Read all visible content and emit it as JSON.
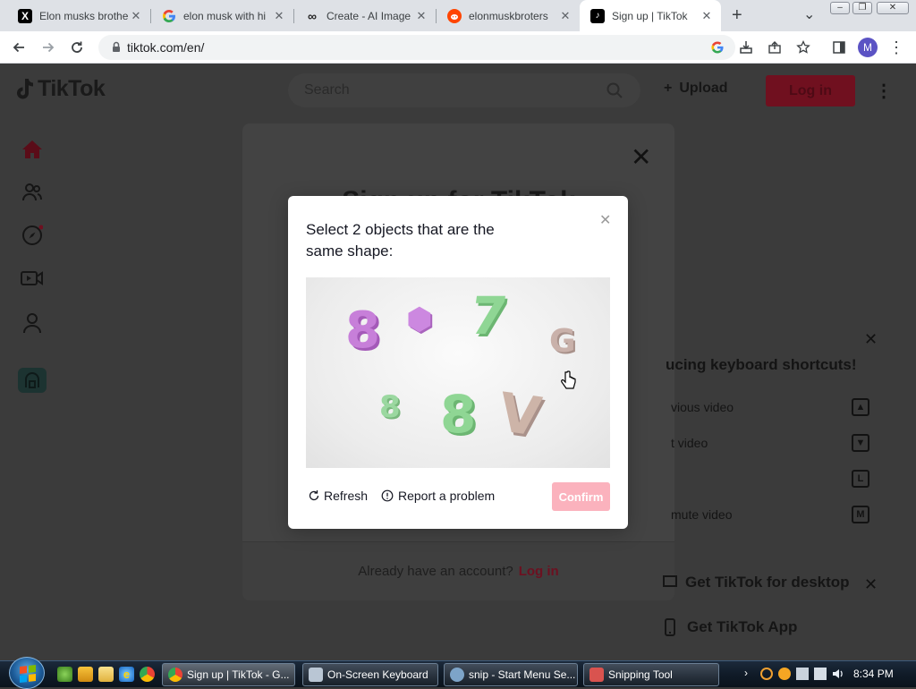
{
  "browser": {
    "tabs": [
      {
        "title": "Elon musks brothe",
        "favicon": "x-logo-icon"
      },
      {
        "title": "elon musk with hi",
        "favicon": "google-icon"
      },
      {
        "title": "Create - AI Image",
        "favicon": "infinity-icon"
      },
      {
        "title": "elonmuskbroters",
        "favicon": "reddit-icon"
      },
      {
        "title": "Sign up | TikTok",
        "favicon": "tiktok-icon"
      }
    ],
    "new_tab_icon": "+",
    "tab_menu_icon": "⌄",
    "url": "tiktok.com/en/",
    "profile_initial": "M"
  },
  "tiktok": {
    "logo_text": "TikTok",
    "search_placeholder": "Search",
    "upload_label": "Upload",
    "login_label": "Log in"
  },
  "signup_modal": {
    "title": "Sign up for TikTok",
    "footer_text": "Already have an account?",
    "footer_link": "Log in"
  },
  "shortcuts_panel": {
    "title": "ucing keyboard shortcuts!",
    "rows": [
      {
        "label": "vious video",
        "key": "▲"
      },
      {
        "label": "t video",
        "key": "▼"
      },
      {
        "label": "",
        "key": "L"
      },
      {
        "label": "mute video",
        "key": "M"
      }
    ],
    "promo_desktop": "Get TikTok for desktop",
    "promo_app": "Get TikTok App"
  },
  "captcha": {
    "title": "Select 2 objects that are the same shape:",
    "objects": [
      {
        "glyph": "8",
        "color": "#c77fd9"
      },
      {
        "glyph": "⬢",
        "color": "#cc88e0"
      },
      {
        "glyph": "7",
        "color": "#8fd694"
      },
      {
        "glyph": "G",
        "color": "#c9b1aa"
      },
      {
        "glyph": "8",
        "color": "#9bd8a0"
      },
      {
        "glyph": "8",
        "color": "#8fd694"
      },
      {
        "glyph": "V",
        "color": "#cdb4a8"
      }
    ],
    "refresh_label": "Refresh",
    "report_label": "Report a problem",
    "confirm_label": "Confirm"
  },
  "taskbar": {
    "buttons": [
      {
        "label": "Sign up | TikTok - G...",
        "active": true
      },
      {
        "label": "On-Screen Keyboard",
        "active": false
      },
      {
        "label": "snip - Start Menu Se...",
        "active": false
      },
      {
        "label": "Snipping Tool",
        "active": false
      }
    ],
    "clock": "8:34 PM"
  },
  "colors": {
    "tiktok_red": "#fe2c55",
    "confirm_disabled": "#fbb2bd",
    "chrome_tabstrip": "#dee1e6"
  }
}
